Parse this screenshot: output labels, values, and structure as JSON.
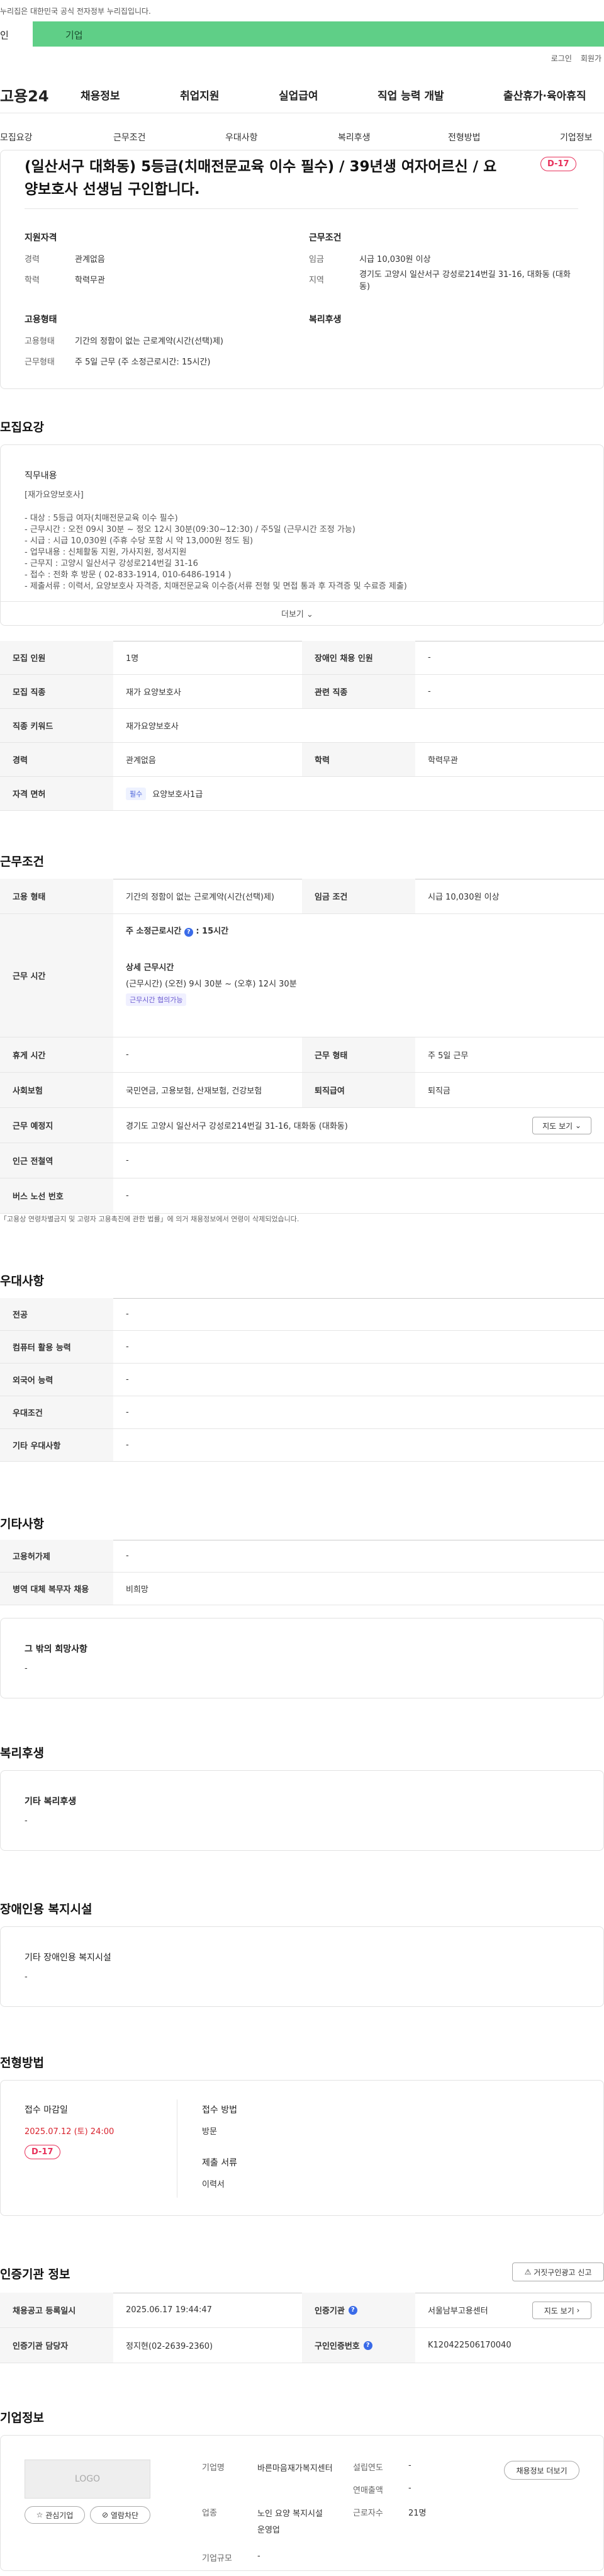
{
  "gov_notice": "이 누리집은 대한민국 공식 전자정부 누리집입니다.",
  "gov_notice_visible": "누리집은 대한민국 공식 전자정부 누리집입니다.",
  "tabs": {
    "individual": "인",
    "company": "기업"
  },
  "util": {
    "login": "로그인",
    "join": "회원가"
  },
  "logo": "고용24",
  "gnb": [
    "채용정보",
    "취업지원",
    "실업급여",
    "직업 능력 개발",
    "출산휴가·육아휴직"
  ],
  "subnav": [
    "모집요강",
    "근무조건",
    "우대사항",
    "복리후생",
    "전형방법",
    "기업정보"
  ],
  "header": {
    "title": "(일산서구 대화동) 5등급(치매전문교육 이수 필수) / 39년생 여자어르신 / 요양보호사 선생님 구인합니다.",
    "dday": "D-17",
    "qual_title": "지원자격",
    "career_label": "경력",
    "career_val": "관계없음",
    "edu_label": "학력",
    "edu_val": "학력무관",
    "cond_title": "근무조건",
    "wage_label": "임금",
    "wage_val": "시급 10,030원 이상",
    "region_label": "지역",
    "region_val": "경기도 고양시 일산서구 강성로214번길 31-16, 대화동 (대화동)",
    "emp_title": "고용형태",
    "emptype_label": "고용형태",
    "emptype_val": "기간의 정함이 없는 근로계약(시간(선택)제)",
    "workform_label": "근무형태",
    "workform_val": "주 5일 근무 (주 소정근로시간: 15시간)",
    "welfare_title": "복리후생"
  },
  "recruit": {
    "heading": "모집요강",
    "job_title": "직무내용",
    "job_sub": "[재가요양보호사]",
    "lines": [
      "- 대상 : 5등급 여자(치매전문교육 이수 필수)",
      "- 근무시간 : 오전 09시 30분 ~ 정오 12시 30분(09:30~12:30) / 주5일 (근무시간 조정 가능)",
      "- 시급 : 시급 10,030원 (주휴 수당 포함 시 약 13,000원 정도 됨)",
      "- 업무내용 : 신체활동 지원, 가사지원, 정서지원",
      "- 근무지 : 고양시 일산서구 강성로214번길 31-16",
      "- 접수 : 전화 후 방문 ( 02-833-1914, 010-6486-1914 )",
      "- 제출서류 : 이력서, 요양보호사 자격증, 치매전문교육 이수증(서류 전형 및 면접 통과 후 자격증 및 수료증 제출)"
    ],
    "more": "더보기",
    "rows": [
      {
        "l1": "모집 인원",
        "v1": "1명",
        "l2": "장애인 채용 인원",
        "v2": "-"
      },
      {
        "l1": "모집 직종",
        "v1": "재가 요양보호사",
        "l2": "관련 직종",
        "v2": "-"
      },
      {
        "l1": "직종 키워드",
        "v1": "재가요양보호사"
      },
      {
        "l1": "경력",
        "v1": "관계없음",
        "l2": "학력",
        "v2": "학력무관"
      },
      {
        "l1": "자격 면허",
        "badge": "필수",
        "v1": "요양보호사1급"
      }
    ]
  },
  "conditions": {
    "heading": "근무조건",
    "emp_label": "고용 형태",
    "emp_val": "기간의 정함이 없는 근로계약(시간(선택)제)",
    "wage_label": "임금 조건",
    "wage_val": "시급 10,030원 이상",
    "time_label": "근무 시간",
    "time_total": "주 소정근로시간",
    "time_total_val": ": 15시간",
    "time_detail_title": "상세 근무시간",
    "time_detail": "(근무시간) (오전) 9시 30분 ~ (오후) 12시 30분",
    "time_tag": "근무시간 협의가능",
    "rest_label": "휴게 시간",
    "rest_val": "-",
    "form_label": "근무 형태",
    "form_val": "주 5일 근무",
    "ins_label": "사회보험",
    "ins_val": "국민연금, 고용보험, 산재보험, 건강보험",
    "retire_label": "퇴직급여",
    "retire_val": "퇴직금",
    "place_label": "근무 예정지",
    "place_val": "경기도 고양시 일산서구 강성로214번길 31-16, 대화동 (대화동)",
    "map_btn": "지도 보기",
    "station_label": "인근 전철역",
    "station_val": "-",
    "bus_label": "버스 노선 번호",
    "bus_val": "-",
    "note": "「고용상 연령차별금지 및 고령자 고용촉진에 관한 법률」에 의거 채용정보에서 연령이 삭제되었습니다."
  },
  "preference": {
    "heading": "우대사항",
    "rows": [
      {
        "l": "전공",
        "v": "-"
      },
      {
        "l": "컴퓨터 활용 능력",
        "v": "-"
      },
      {
        "l": "외국어 능력",
        "v": "-"
      },
      {
        "l": "우대조건",
        "v": "-"
      },
      {
        "l": "기타 우대사항",
        "v": "-"
      }
    ]
  },
  "etc": {
    "heading": "기타사항",
    "rows": [
      {
        "l": "고용허가제",
        "v": "-"
      },
      {
        "l": "병역 대체 복무자 채용",
        "v": "비희망"
      }
    ],
    "other_title": "그 밖의 희망사항",
    "other_val": "-"
  },
  "welfare": {
    "heading": "복리후생",
    "title": "기타 복리후생",
    "val": "-"
  },
  "disabled": {
    "heading": "장애인용 복지시설",
    "title": "기타 장애인용 복지시설",
    "val": "-"
  },
  "selection": {
    "heading": "전형방법",
    "deadline_title": "접수 마감일",
    "deadline": "2025.07.12 (토) 24:00",
    "dday": "D-17",
    "method_title": "접수 방법",
    "method_val": "방문",
    "docs_title": "제출 서류",
    "docs_val": "이력서"
  },
  "cert": {
    "heading": "인증기관 정보",
    "report_btn": "거짓구인광고 신고",
    "reg_label": "채용공고 등록일시",
    "reg_val": "2025.06.17 19:44:47",
    "org_label": "인증기관",
    "org_val": "서울남부고용센터",
    "map_btn": "지도 보기",
    "mgr_label": "인증기관 담당자",
    "mgr_val": "정지현(02-2639-2360)",
    "num_label": "구인인증번호",
    "num_val": "K120422506170040"
  },
  "company": {
    "heading": "기업정보",
    "logo": "LOGO",
    "fav": "관심기업",
    "block": "열람차단",
    "name_label": "기업명",
    "name_val": "바른마음재가복지센터",
    "biz_label": "업종",
    "biz_val": "노인 요양 복지시설 운영업",
    "size_label": "기업규모",
    "size_val": "-",
    "found_label": "설립연도",
    "found_val": "-",
    "sales_label": "연매출액",
    "sales_val": "-",
    "emp_label": "근로자수",
    "emp_val": "21명",
    "jobs_btn": "채용정보 더보기"
  }
}
